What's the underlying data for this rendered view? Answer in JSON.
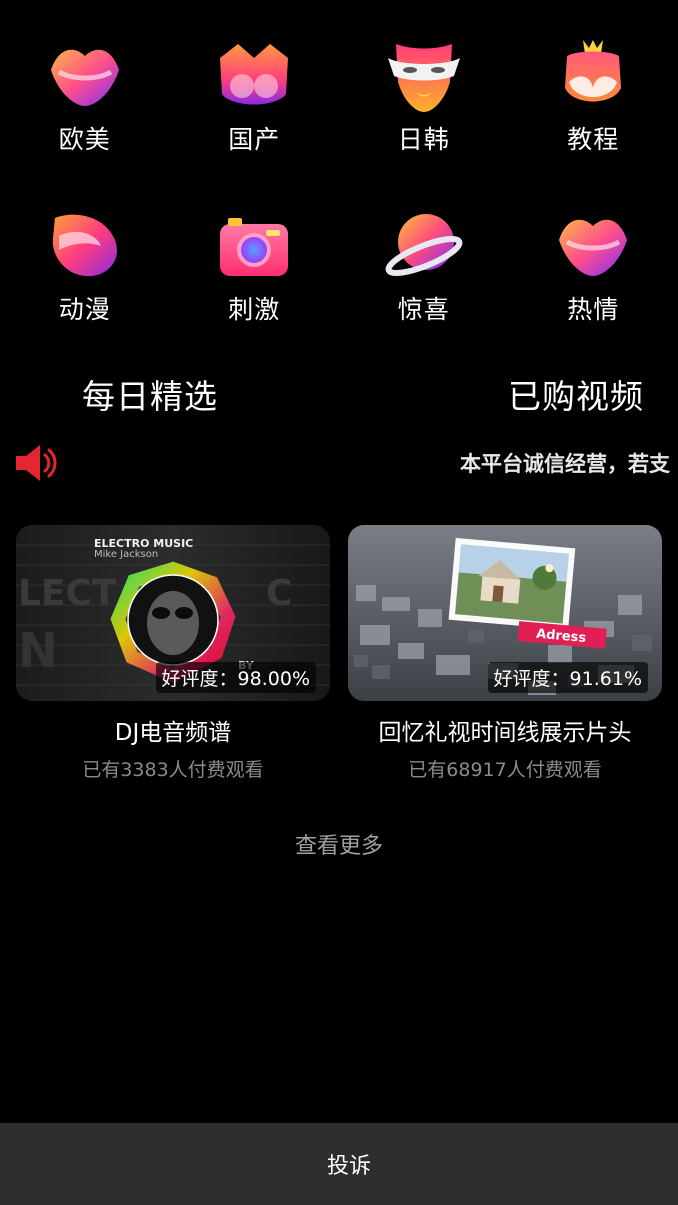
{
  "categories": [
    {
      "label": "欧美",
      "icon": "lips-icon"
    },
    {
      "label": "国产",
      "icon": "bust-icon"
    },
    {
      "label": "日韩",
      "icon": "mask-icon"
    },
    {
      "label": "教程",
      "icon": "crown-body-icon"
    },
    {
      "label": "动漫",
      "icon": "anime-shape-icon"
    },
    {
      "label": "刺激",
      "icon": "camera-icon"
    },
    {
      "label": "惊喜",
      "icon": "planet-icon"
    },
    {
      "label": "热情",
      "icon": "lips-icon"
    }
  ],
  "tabs": {
    "daily": "每日精选",
    "purchased": "已购视频"
  },
  "notice": {
    "text": "本平台诚信经营，若支",
    "icon": "speaker-icon"
  },
  "videos": [
    {
      "title": "DJ电音频谱",
      "rating": "好评度：98.00%",
      "paid": "已有3383人付费观看",
      "thumb_title": "ELECTRO MUSIC",
      "thumb_subtitle": "Mike Jackson",
      "thumb_tag": "BY"
    },
    {
      "title": "回忆礼视时间线展示片头",
      "rating": "好评度：91.61%",
      "paid": "已有68917人付费观看",
      "thumb_tag": "Adress"
    }
  ],
  "more": "查看更多",
  "footer": {
    "report": "投诉"
  },
  "colors": {
    "accent": "#ff3b6b",
    "gradient_a": "#ffb03a",
    "gradient_b": "#7a2cff"
  }
}
